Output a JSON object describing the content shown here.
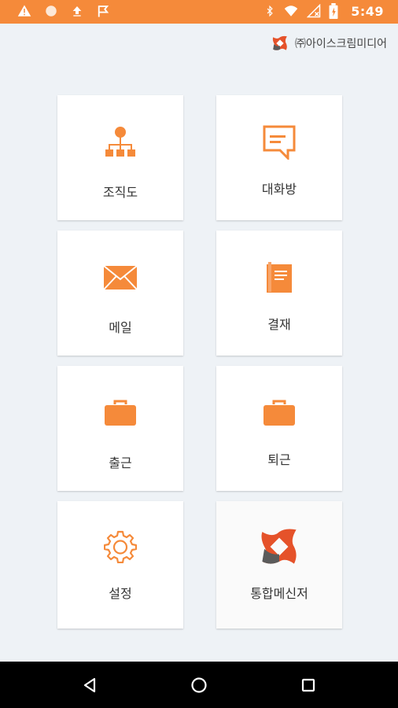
{
  "status_bar": {
    "time": "5:49",
    "left_icons": [
      "warning-icon",
      "circle-icon",
      "upload-icon",
      "flag-icon"
    ],
    "right_icons": [
      "bluetooth-icon",
      "wifi-icon",
      "signal-icon",
      "battery-icon"
    ],
    "color": "#f58a3a"
  },
  "header": {
    "company": "㈜아이스크림미디어"
  },
  "menu": [
    {
      "label": "조직도",
      "icon": "org-chart-icon"
    },
    {
      "label": "대화방",
      "icon": "chat-bubble-icon"
    },
    {
      "label": "메일",
      "icon": "mail-icon"
    },
    {
      "label": "결재",
      "icon": "document-icon"
    },
    {
      "label": "출근",
      "icon": "briefcase-icon"
    },
    {
      "label": "퇴근",
      "icon": "briefcase-icon"
    },
    {
      "label": "설정",
      "icon": "gear-icon"
    },
    {
      "label": "통합메신저",
      "icon": "messenger-logo-icon"
    }
  ],
  "colors": {
    "accent": "#f58a3a",
    "background": "#eef2f6"
  }
}
